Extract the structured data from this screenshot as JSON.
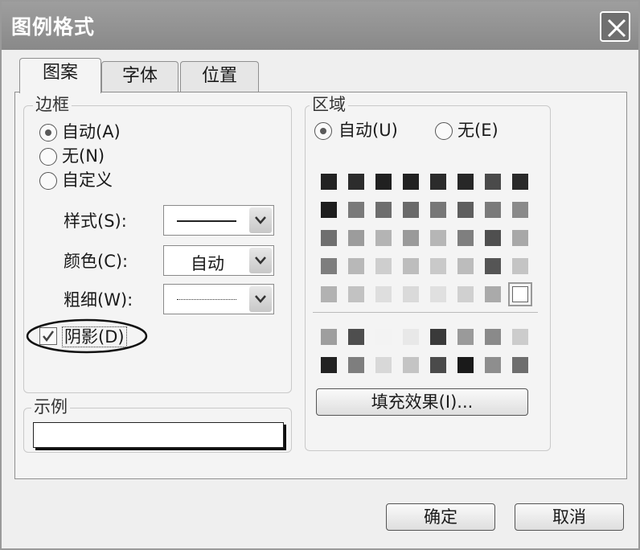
{
  "dialog": {
    "title": "图例格式"
  },
  "tabs": [
    {
      "label": "图案",
      "active": true
    },
    {
      "label": "字体",
      "active": false
    },
    {
      "label": "位置",
      "active": false
    }
  ],
  "border": {
    "legend": "边框",
    "radio_auto": "自动(A)",
    "radio_none": "无(N)",
    "radio_custom": "自定义",
    "selected": "auto",
    "style_label": "样式(S):",
    "color_label": "颜色(C):",
    "color_value": "自动",
    "weight_label": "粗细(W):",
    "shadow_label": "阴影(D)",
    "shadow_checked": true
  },
  "sample": {
    "legend": "示例"
  },
  "area": {
    "legend": "区域",
    "radio_auto": "自动(U)",
    "radio_none": "无(E)",
    "selected": "auto",
    "palette_main": [
      [
        "#222222",
        "#2c2c2c",
        "#202020",
        "#222222",
        "#2b2b2b",
        "#272727",
        "#4a4a4a",
        "#2a2a2a"
      ],
      [
        "#1e1e1e",
        "#7a7a7a",
        "#6e6e6e",
        "#6a6a6a",
        "#777777",
        "#5e5e5e",
        "#7a7a7a",
        "#8a8a8a"
      ],
      [
        "#6f6f6f",
        "#9c9c9c",
        "#b4b4b4",
        "#9a9a9a",
        "#b6b6b6",
        "#7f7f7f",
        "#4f4f4f",
        "#a8a8a8"
      ],
      [
        "#7e7e7e",
        "#b8b8b8",
        "#cecece",
        "#bdbdbd",
        "#c9c9c9",
        "#bcbcbc",
        "#555555",
        "#c4c4c4"
      ],
      [
        "#b2b2b2",
        "#c2c2c2",
        "#dedede",
        "#dadada",
        "#e0e0e0",
        "#d0d0d0",
        "#aaaaaa",
        "#ffffff"
      ]
    ],
    "palette_extra": [
      [
        "#9e9e9e",
        "#4e4e4e",
        "#f3f3f3",
        "#e8e8e8",
        "#3a3a3a",
        "#9a9a9a",
        "#8a8a8a",
        "#cccccc"
      ],
      [
        "#222222",
        "#7e7e7e",
        "#d8d8d8",
        "#c4c4c4",
        "#4a4a4a",
        "#1a1a1a",
        "#8e8e8e",
        "#6e6e6e"
      ]
    ],
    "fill_effects_label": "填充效果(I)..."
  },
  "footer": {
    "ok_label": "确定",
    "cancel_label": "取消"
  }
}
